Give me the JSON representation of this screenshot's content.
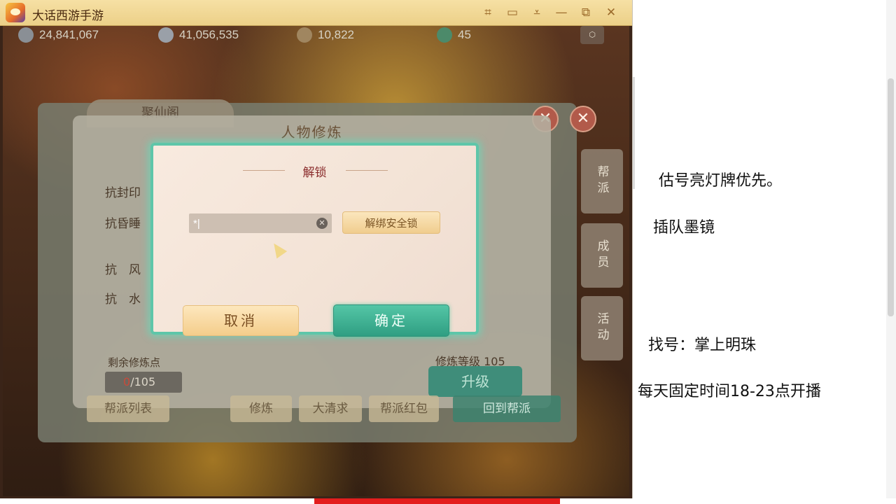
{
  "window": {
    "title": "大话西游手游",
    "controls": [
      "crop-icon",
      "chat-icon",
      "dropdown-icon",
      "minimize-icon",
      "restore-icon",
      "close-icon"
    ]
  },
  "resources": [
    {
      "icon": "silver-coin-icon",
      "value": "24,841,067"
    },
    {
      "icon": "coin-stack-icon",
      "value": "41,056,535"
    },
    {
      "icon": "gold-ingot-icon",
      "value": "10,822"
    },
    {
      "icon": "jade-icon",
      "value": "45"
    }
  ],
  "background_panel": {
    "tab_label": "聚仙阁",
    "side_tabs": [
      "帮派",
      "成员",
      "活动"
    ],
    "bottom_buttons": [
      "帮派列表",
      "修炼",
      "大清求",
      "帮派红包",
      "回到帮派"
    ]
  },
  "xiulian_panel": {
    "title": "人物修炼",
    "rows": [
      "抗封印",
      "抗昏睡",
      "抗　风",
      "抗　水"
    ],
    "remaining_points_label": "剩余修炼点",
    "points_current": "0",
    "points_total": "/105",
    "level_label": "修炼等级 105",
    "upgrade_label": "升级"
  },
  "unlock_dialog": {
    "title": "解锁",
    "password_value": "*|",
    "unbind_label": "解绑安全锁",
    "cancel_label": "取消",
    "confirm_label": "确定",
    "accent": "#5ec6a9"
  },
  "notes": [
    "估号亮灯牌优先。",
    "插队墨镜",
    "找号：掌上明珠",
    "每天固定时间18-23点开播"
  ]
}
